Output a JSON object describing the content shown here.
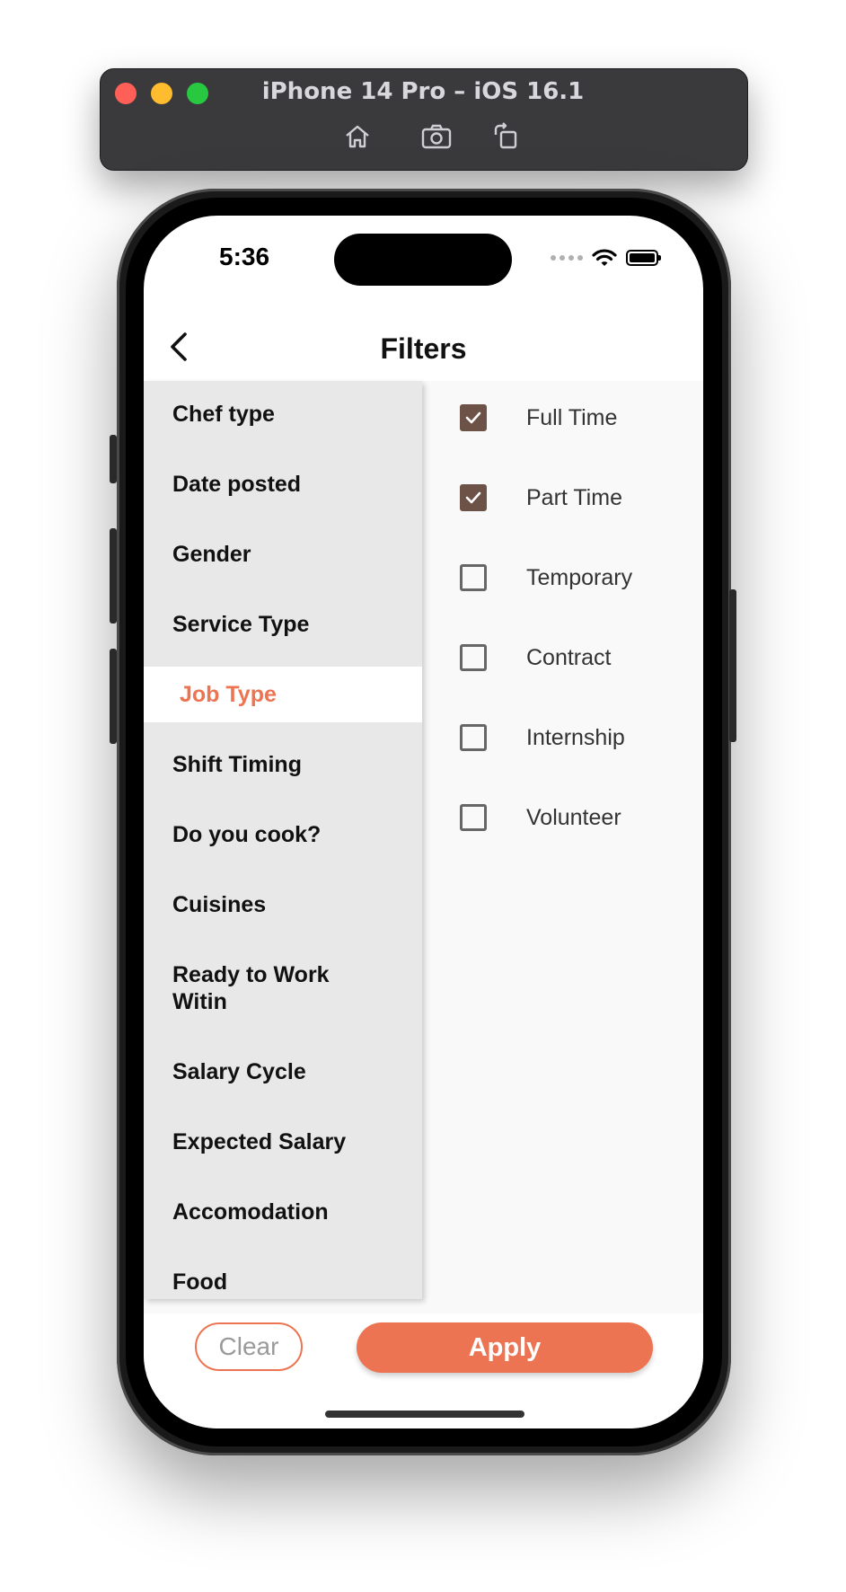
{
  "simulator": {
    "title": "iPhone 14 Pro – iOS 16.1",
    "controls": [
      "home-icon",
      "screenshot-icon",
      "rotate-icon"
    ]
  },
  "status_bar": {
    "time": "5:36"
  },
  "header": {
    "title": "Filters"
  },
  "categories": [
    {
      "label": "Chef type"
    },
    {
      "label": "Date posted"
    },
    {
      "label": "Gender"
    },
    {
      "label": "Service Type"
    },
    {
      "label": "Job Type",
      "selected": true
    },
    {
      "label": "Shift Timing"
    },
    {
      "label": "Do you cook?"
    },
    {
      "label": "Cuisines"
    },
    {
      "label": "Ready to Work Witin"
    },
    {
      "label": "Salary Cycle"
    },
    {
      "label": "Expected Salary"
    },
    {
      "label": "Accomodation"
    },
    {
      "label": "Food"
    }
  ],
  "options": [
    {
      "label": "Full Time",
      "checked": true
    },
    {
      "label": "Part Time",
      "checked": true
    },
    {
      "label": "Temporary",
      "checked": false
    },
    {
      "label": "Contract",
      "checked": false
    },
    {
      "label": "Internship",
      "checked": false
    },
    {
      "label": "Volunteer",
      "checked": false
    }
  ],
  "footer": {
    "clear_label": "Clear",
    "apply_label": "Apply"
  },
  "colors": {
    "accent": "#ec7452",
    "checkbox_fill": "#6d5248",
    "sidebar_bg": "#e8e8e8"
  }
}
